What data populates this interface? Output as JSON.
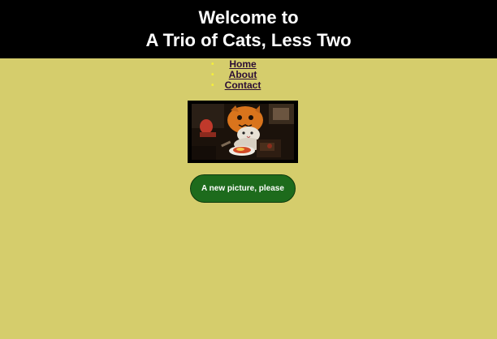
{
  "header": {
    "title_line1": "Welcome to",
    "title_line2": "A Trio of Cats, Less Two"
  },
  "nav": {
    "items": [
      {
        "label": "Home"
      },
      {
        "label": "About"
      },
      {
        "label": "Contact"
      }
    ]
  },
  "photo": {
    "icon": "cat-photo"
  },
  "button": {
    "label": "A new picture, please"
  },
  "colors": {
    "page_background": "#d5cd6c",
    "header_background": "#000000",
    "button_background": "#1d6b1c",
    "nav_link": "#2b0d35",
    "bullet": "#f4ef3a"
  }
}
